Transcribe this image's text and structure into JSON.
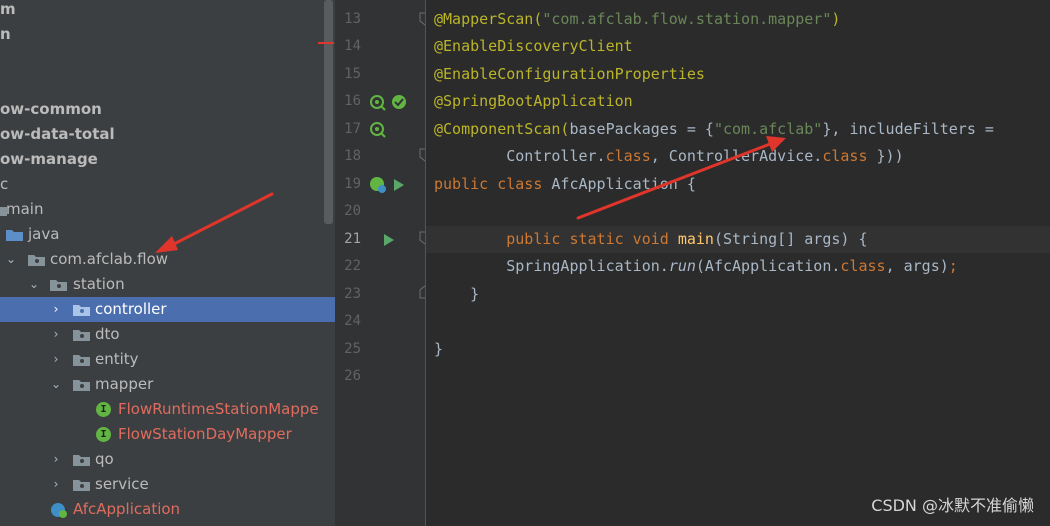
{
  "tree": {
    "items": [
      {
        "label": "m",
        "bold": true
      },
      {
        "label": "n",
        "bold": true
      },
      {
        "label": "",
        "bold": false
      },
      {
        "label": "",
        "bold": false
      },
      {
        "label": "ow-common",
        "bold": true
      },
      {
        "label": "ow-data-total",
        "bold": true
      },
      {
        "label": "ow-manage",
        "bold": true
      },
      {
        "label": "c",
        "bold": false
      },
      {
        "label": "main",
        "bold": false
      },
      {
        "label": "java",
        "bold": false
      },
      {
        "label": "com.afclab.flow",
        "bold": false
      },
      {
        "label": "station",
        "bold": false
      },
      {
        "label": "controller",
        "bold": false
      },
      {
        "label": "dto",
        "bold": false
      },
      {
        "label": "entity",
        "bold": false
      },
      {
        "label": "mapper",
        "bold": false
      },
      {
        "label": "FlowRuntimeStationMappe",
        "bold": false
      },
      {
        "label": "FlowStationDayMapper",
        "bold": false
      },
      {
        "label": "qo",
        "bold": false
      },
      {
        "label": "service",
        "bold": false
      },
      {
        "label": "AfcApplication",
        "bold": false
      }
    ],
    "interface_badge": "I"
  },
  "editor": {
    "line_numbers": [
      "13",
      "14",
      "15",
      "16",
      "17",
      "18",
      "19",
      "20",
      "21",
      "22",
      "23",
      "24",
      "25",
      "26"
    ],
    "current_line": "21",
    "lines": {
      "l13a": "@MapperScan(",
      "l13b": "\"com.afclab.flow.station.mapper\"",
      "l13c": ")",
      "l14": "@EnableDiscoveryClient",
      "l15": "@EnableConfigurationProperties",
      "l16": "@SpringBootApplication",
      "l17a": "@ComponentScan(",
      "l17b": "basePackages = {",
      "l17c": "\"com.afclab\"",
      "l17d": "}, ",
      "l17e": "includeFilters =",
      "l18a": "        Controller.",
      "l18b": "class",
      "l18c": ", ControllerAdvice.",
      "l18d": "class",
      "l18e": " }))",
      "l19a": "public class ",
      "l19b": "AfcApplication {",
      "l21a": "        public static void ",
      "l21b": "main",
      "l21c": "(String[] args) {",
      "l22a": "        SpringApplication.",
      "l22b": "run",
      "l22c": "(AfcApplication.",
      "l22d": "class",
      "l22e": ", args)",
      "l22f": ";",
      "l23": "    }",
      "l25": "}"
    }
  },
  "watermark": "CSDN @冰默不准偷懒",
  "colors": {
    "accent_selection": "#4b6eaf",
    "annotation_arrow": "#e0352b"
  }
}
